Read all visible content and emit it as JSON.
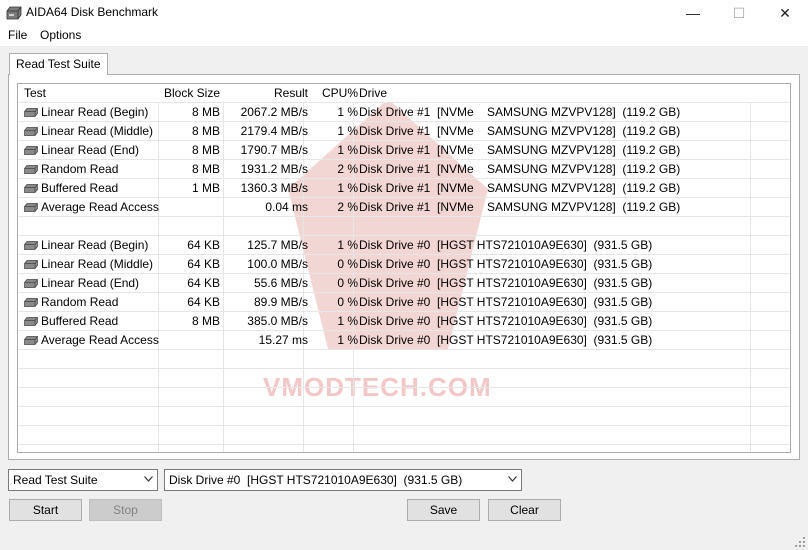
{
  "window": {
    "title": "AIDA64 Disk Benchmark",
    "minimize": "—",
    "maximize": "☐",
    "close": "✕"
  },
  "menu": {
    "file": "File",
    "options": "Options"
  },
  "tab": {
    "label": "Read Test Suite"
  },
  "table": {
    "headers": {
      "test": "Test",
      "block": "Block Size",
      "result": "Result",
      "cpu": "CPU%",
      "drive": "Drive"
    },
    "group1": [
      {
        "test": "Linear Read (Begin)",
        "block": "8 MB",
        "result": "2067.2 MB/s",
        "cpu": "1 %",
        "drive": "Disk Drive #1  [NVMe    SAMSUNG MZVPV128]  (119.2 GB)"
      },
      {
        "test": "Linear Read (Middle)",
        "block": "8 MB",
        "result": "2179.4 MB/s",
        "cpu": "1 %",
        "drive": "Disk Drive #1  [NVMe    SAMSUNG MZVPV128]  (119.2 GB)"
      },
      {
        "test": "Linear Read (End)",
        "block": "8 MB",
        "result": "1790.7 MB/s",
        "cpu": "1 %",
        "drive": "Disk Drive #1  [NVMe    SAMSUNG MZVPV128]  (119.2 GB)"
      },
      {
        "test": "Random Read",
        "block": "8 MB",
        "result": "1931.2 MB/s",
        "cpu": "2 %",
        "drive": "Disk Drive #1  [NVMe    SAMSUNG MZVPV128]  (119.2 GB)"
      },
      {
        "test": "Buffered Read",
        "block": "1 MB",
        "result": "1360.3 MB/s",
        "cpu": "1 %",
        "drive": "Disk Drive #1  [NVMe    SAMSUNG MZVPV128]  (119.2 GB)"
      },
      {
        "test": "Average Read Access",
        "block": "",
        "result": "0.04 ms",
        "cpu": "2 %",
        "drive": "Disk Drive #1  [NVMe    SAMSUNG MZVPV128]  (119.2 GB)"
      }
    ],
    "group2": [
      {
        "test": "Linear Read (Begin)",
        "block": "64 KB",
        "result": "125.7 MB/s",
        "cpu": "1 %",
        "drive": "Disk Drive #0  [HGST HTS721010A9E630]  (931.5 GB)"
      },
      {
        "test": "Linear Read (Middle)",
        "block": "64 KB",
        "result": "100.0 MB/s",
        "cpu": "0 %",
        "drive": "Disk Drive #0  [HGST HTS721010A9E630]  (931.5 GB)"
      },
      {
        "test": "Linear Read (End)",
        "block": "64 KB",
        "result": "55.6 MB/s",
        "cpu": "0 %",
        "drive": "Disk Drive #0  [HGST HTS721010A9E630]  (931.5 GB)"
      },
      {
        "test": "Random Read",
        "block": "64 KB",
        "result": "89.9 MB/s",
        "cpu": "0 %",
        "drive": "Disk Drive #0  [HGST HTS721010A9E630]  (931.5 GB)"
      },
      {
        "test": "Buffered Read",
        "block": "8 MB",
        "result": "385.0 MB/s",
        "cpu": "1 %",
        "drive": "Disk Drive #0  [HGST HTS721010A9E630]  (931.5 GB)"
      },
      {
        "test": "Average Read Access",
        "block": "",
        "result": "15.27 ms",
        "cpu": "1 %",
        "drive": "Disk Drive #0  [HGST HTS721010A9E630]  (931.5 GB)"
      }
    ]
  },
  "watermark": {
    "text": "VMODTECH.COM"
  },
  "controls": {
    "suite_select": "Read Test Suite",
    "drive_select": "Disk Drive #0  [HGST HTS721010A9E630]  (931.5 GB)",
    "start": "Start",
    "stop": "Stop",
    "save": "Save",
    "clear": "Clear"
  },
  "icons": {
    "app": "disk-drive-icon",
    "row": "hard-disk-icon",
    "dropdown": "chevron-down-icon"
  }
}
